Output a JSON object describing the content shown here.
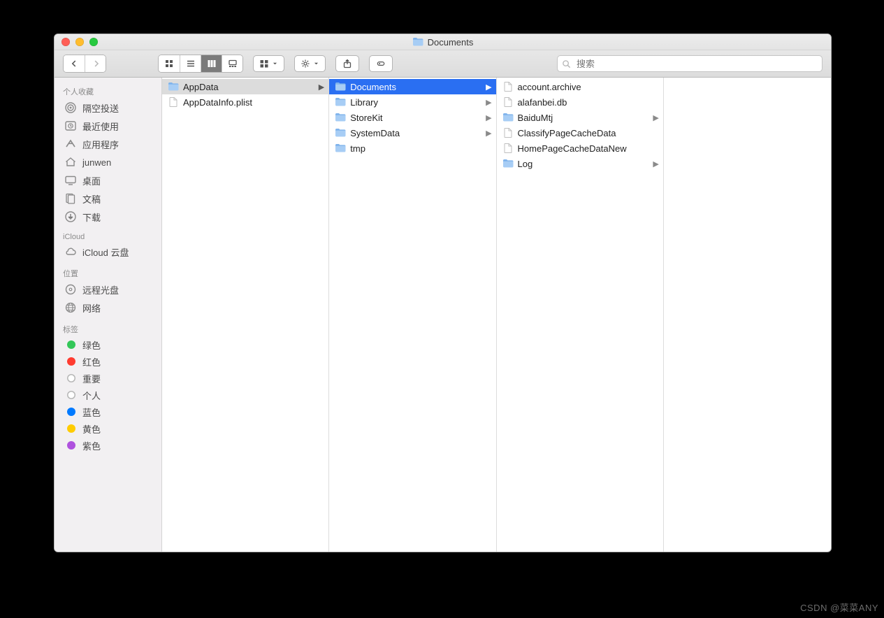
{
  "window": {
    "title": "Documents"
  },
  "search": {
    "placeholder": "搜索"
  },
  "sidebar": {
    "sections": [
      {
        "title": "个人收藏",
        "items": [
          {
            "icon": "airdrop",
            "label": "隔空投送"
          },
          {
            "icon": "clock",
            "label": "最近使用"
          },
          {
            "icon": "apps",
            "label": "应用程序"
          },
          {
            "icon": "home",
            "label": "junwen"
          },
          {
            "icon": "desktop",
            "label": "桌面"
          },
          {
            "icon": "doc",
            "label": "文稿"
          },
          {
            "icon": "download",
            "label": "下载"
          }
        ]
      },
      {
        "title": "iCloud",
        "items": [
          {
            "icon": "cloud",
            "label": "iCloud 云盘"
          }
        ]
      },
      {
        "title": "位置",
        "items": [
          {
            "icon": "disc",
            "label": "远程光盘"
          },
          {
            "icon": "globe",
            "label": "网络"
          }
        ]
      }
    ],
    "tagsTitle": "标签",
    "tags": [
      {
        "color": "#34c759",
        "label": "绿色"
      },
      {
        "color": "#ff3b30",
        "label": "红色"
      },
      {
        "color": "#ffffff",
        "label": "重要",
        "ring": true
      },
      {
        "color": "#ffffff",
        "label": "个人",
        "ring": true
      },
      {
        "color": "#007aff",
        "label": "蓝色"
      },
      {
        "color": "#ffcc00",
        "label": "黄色"
      },
      {
        "color": "#af52de",
        "label": "紫色"
      }
    ]
  },
  "columns": [
    {
      "items": [
        {
          "type": "folder",
          "label": "AppData",
          "hasChildren": true,
          "selected": "bg"
        },
        {
          "type": "file",
          "label": "AppDataInfo.plist"
        }
      ]
    },
    {
      "items": [
        {
          "type": "folder",
          "label": "Documents",
          "hasChildren": true,
          "selected": "active"
        },
        {
          "type": "folder",
          "label": "Library",
          "hasChildren": true
        },
        {
          "type": "folder",
          "label": "StoreKit",
          "hasChildren": true
        },
        {
          "type": "folder",
          "label": "SystemData",
          "hasChildren": true
        },
        {
          "type": "folder",
          "label": "tmp"
        }
      ]
    },
    {
      "items": [
        {
          "type": "file",
          "label": "account.archive"
        },
        {
          "type": "file",
          "label": "alafanbei.db"
        },
        {
          "type": "folder",
          "label": "BaiduMtj",
          "hasChildren": true
        },
        {
          "type": "file",
          "label": "ClassifyPageCacheData"
        },
        {
          "type": "file",
          "label": "HomePageCacheDataNew"
        },
        {
          "type": "folder",
          "label": "Log",
          "hasChildren": true
        }
      ]
    },
    {
      "items": []
    }
  ],
  "watermark": "CSDN @菜菜ANY"
}
